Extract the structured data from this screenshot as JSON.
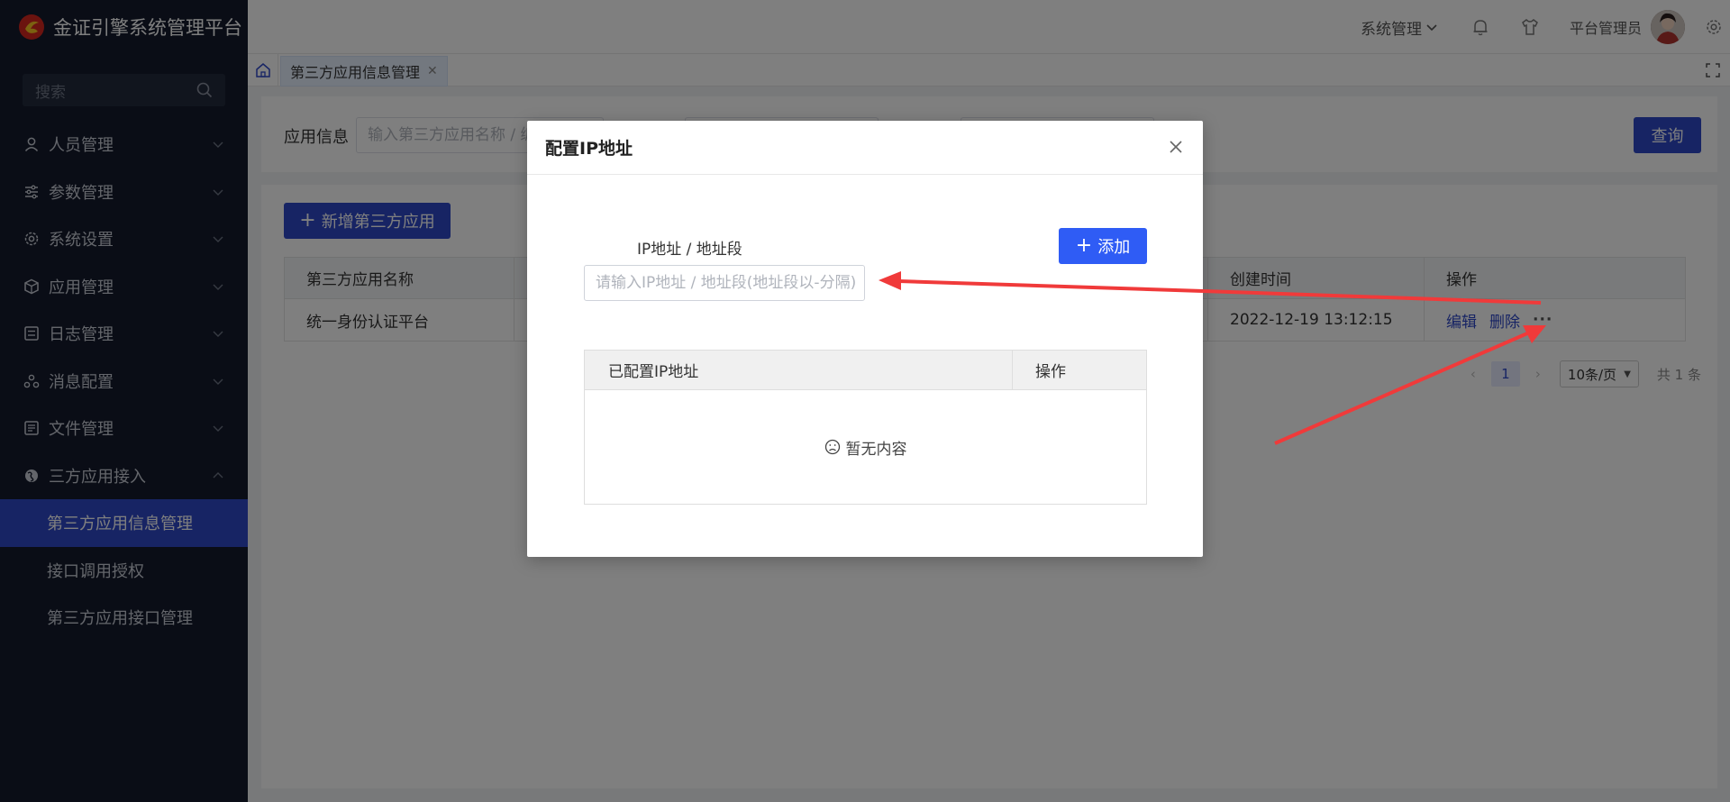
{
  "brand": {
    "title": "金证引擎系统管理平台"
  },
  "sidebar": {
    "search_placeholder": "搜索",
    "items": [
      {
        "label": "人员管理",
        "icon": "user-icon"
      },
      {
        "label": "参数管理",
        "icon": "sliders-icon"
      },
      {
        "label": "系统设置",
        "icon": "gear-icon"
      },
      {
        "label": "应用管理",
        "icon": "cube-icon"
      },
      {
        "label": "日志管理",
        "icon": "log-icon"
      },
      {
        "label": "消息配置",
        "icon": "message-icon"
      },
      {
        "label": "文件管理",
        "icon": "file-icon"
      },
      {
        "label": "三方应用接入",
        "icon": "globe-icon"
      }
    ],
    "subitems": [
      {
        "label": "第三方应用信息管理",
        "active": true
      },
      {
        "label": "接口调用授权",
        "active": false
      },
      {
        "label": "第三方应用接口管理",
        "active": false
      }
    ]
  },
  "header": {
    "system_menu": "系统管理",
    "user_name": "平台管理员"
  },
  "tabs": [
    {
      "label": "第三方应用信息管理"
    }
  ],
  "filter": {
    "label": "应用信息",
    "placeholder": "输入第三方应用名称 / 编码",
    "query_button": "查询"
  },
  "list": {
    "add_button": "新增第三方应用",
    "columns": [
      "第三方应用名称",
      "",
      "创建时间",
      "操作"
    ],
    "rows": [
      {
        "name": "统一身份认证平台",
        "created": "2022-12-19 13:12:15",
        "actions": [
          "编辑",
          "删除",
          "···"
        ]
      }
    ],
    "pager": {
      "page": "1",
      "page_size": "10条/页",
      "total": "共 1 条"
    }
  },
  "modal": {
    "title": "配置IP地址",
    "field_label": "IP地址 / 地址段",
    "input_placeholder": "请输入IP地址 / 地址段(地址段以-分隔)",
    "add_button": "添加",
    "table_columns": [
      "已配置IP地址",
      "操作"
    ],
    "empty_text": "暂无内容"
  },
  "colors": {
    "primary": "#2e48c9",
    "modal_button": "#2f5cf5",
    "sidebar_bg": "#141b2d",
    "annotation_arrow": "#f03a3a"
  }
}
